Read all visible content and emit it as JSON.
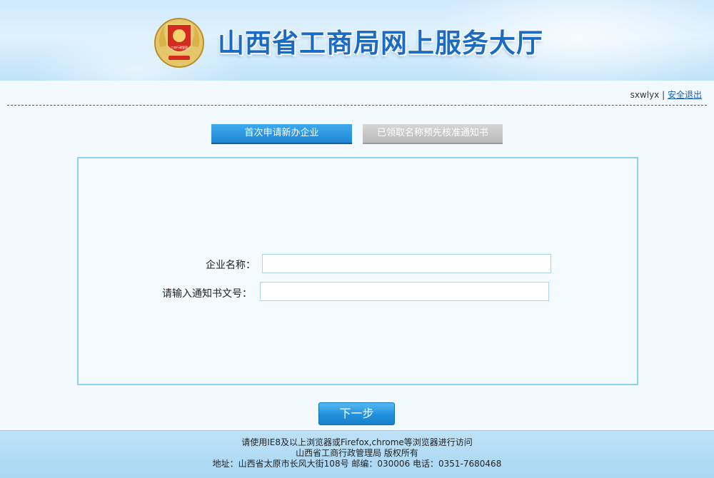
{
  "header": {
    "title": "山西省工商局网上服务大厅",
    "emblem_icon": "national-emblem-icon",
    "emblem_seal_text": "工商行政管理"
  },
  "user": {
    "username": "sxwlyx",
    "separator": "|",
    "logout_label": "安全退出"
  },
  "tabs": [
    {
      "label": "首次申请新办企业",
      "active": true
    },
    {
      "label": "已领取名称预先核准通知书",
      "active": false
    }
  ],
  "form": {
    "company_name_label": "企业名称：",
    "company_name_value": "",
    "notice_number_label": "请输入通知书文号：",
    "notice_number_value": ""
  },
  "actions": {
    "next_label": "下一步"
  },
  "footer": {
    "browser_note": "请使用IE8及以上浏览器或Firefox,chrome等浏览器进行访问",
    "copyright": "山西省工商行政管理局 版权所有",
    "address": "地址：山西省太原市长风大街108号 邮编：030006 电话：0351-7680468"
  },
  "colors": {
    "accent": "#1f87d6",
    "title": "#1c6bc3",
    "tab_inactive": "#b9b9b9",
    "panel_border": "#8fd0f0"
  }
}
